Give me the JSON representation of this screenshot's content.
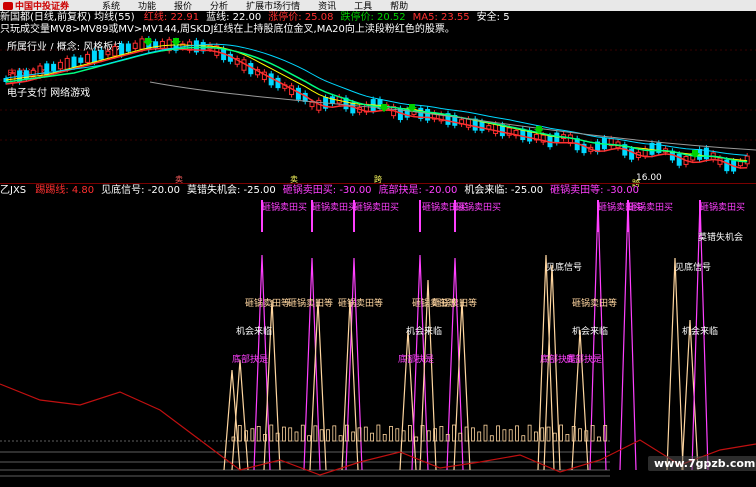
{
  "menu": {
    "logo_text": "中国中投证券",
    "items": [
      "系统",
      "功能",
      "报价",
      "分析",
      "扩展市场行情",
      "资讯",
      "工具",
      "帮助"
    ]
  },
  "main_header": {
    "title": "新国都(日线,前复权)",
    "indicator": "均线(55)",
    "items": [
      {
        "label": "红线:",
        "value": "22.91",
        "color": "#ff3030"
      },
      {
        "label": "蓝线:",
        "value": "22.00",
        "color": "#ffffff"
      },
      {
        "label": "涨停价:",
        "value": "25.08",
        "color": "#ff3030"
      },
      {
        "label": "跌停价:",
        "value": "20.52",
        "color": "#00d000"
      },
      {
        "label": "MA5:",
        "value": "23.55",
        "color": "#ff3030"
      },
      {
        "label": "安全:",
        "value": "5",
        "color": "#ffffff"
      }
    ]
  },
  "note": "只玩成交量MV8>MV89或MV>MV144,周SKDJ红线在上持股底位金叉,MA20向上渎段粉红色的股票。",
  "industry": "所属行业 / 概念: 风格板块",
  "concepts": [
    "电脑设备",
    "电子支付 网络游戏"
  ],
  "markers": {
    "low_price": "16.00",
    "bottom_markers": [
      "卖",
      "卖",
      "跨",
      "跨"
    ]
  },
  "sub_header": {
    "name": "乙JXS",
    "items": [
      {
        "label": "踢踢线:",
        "value": "4.80",
        "color": "#ff3030"
      },
      {
        "label": "见底信号:",
        "value": "-20.00",
        "color": "#ffffff"
      },
      {
        "label": "莫错失机会:",
        "value": "-25.00",
        "color": "#ffffff"
      },
      {
        "label": "砸锅卖田买:",
        "value": "-30.00",
        "color": "#ff40ff"
      },
      {
        "label": "底部抉是:",
        "value": "-20.00",
        "color": "#ff40ff"
      },
      {
        "label": "机会来临:",
        "value": "-25.00",
        "color": "#ffffff"
      },
      {
        "label": "砸锅卖田等:",
        "value": "-30.00",
        "color": "#ff40ff"
      }
    ]
  },
  "signals": {
    "buy": "砸锅卖田买",
    "wait": "砸锅卖田等",
    "opportunity": "机会来临",
    "bottom_signal": "见底信号",
    "dont_miss": "莫错失机会",
    "bottom_fast": "底部抉是"
  },
  "watermark": "www.7gpzb.com",
  "colors": {
    "up": "#ff3030",
    "down": "#00d8ff",
    "ma_short": "#ffffff",
    "ma_mid": "#ffff00",
    "ma_long": "#00ff80",
    "ma_slow": "#9a9a9a",
    "signal_magenta": "#ff40ff",
    "signal_light": "#ffd6a0"
  }
}
